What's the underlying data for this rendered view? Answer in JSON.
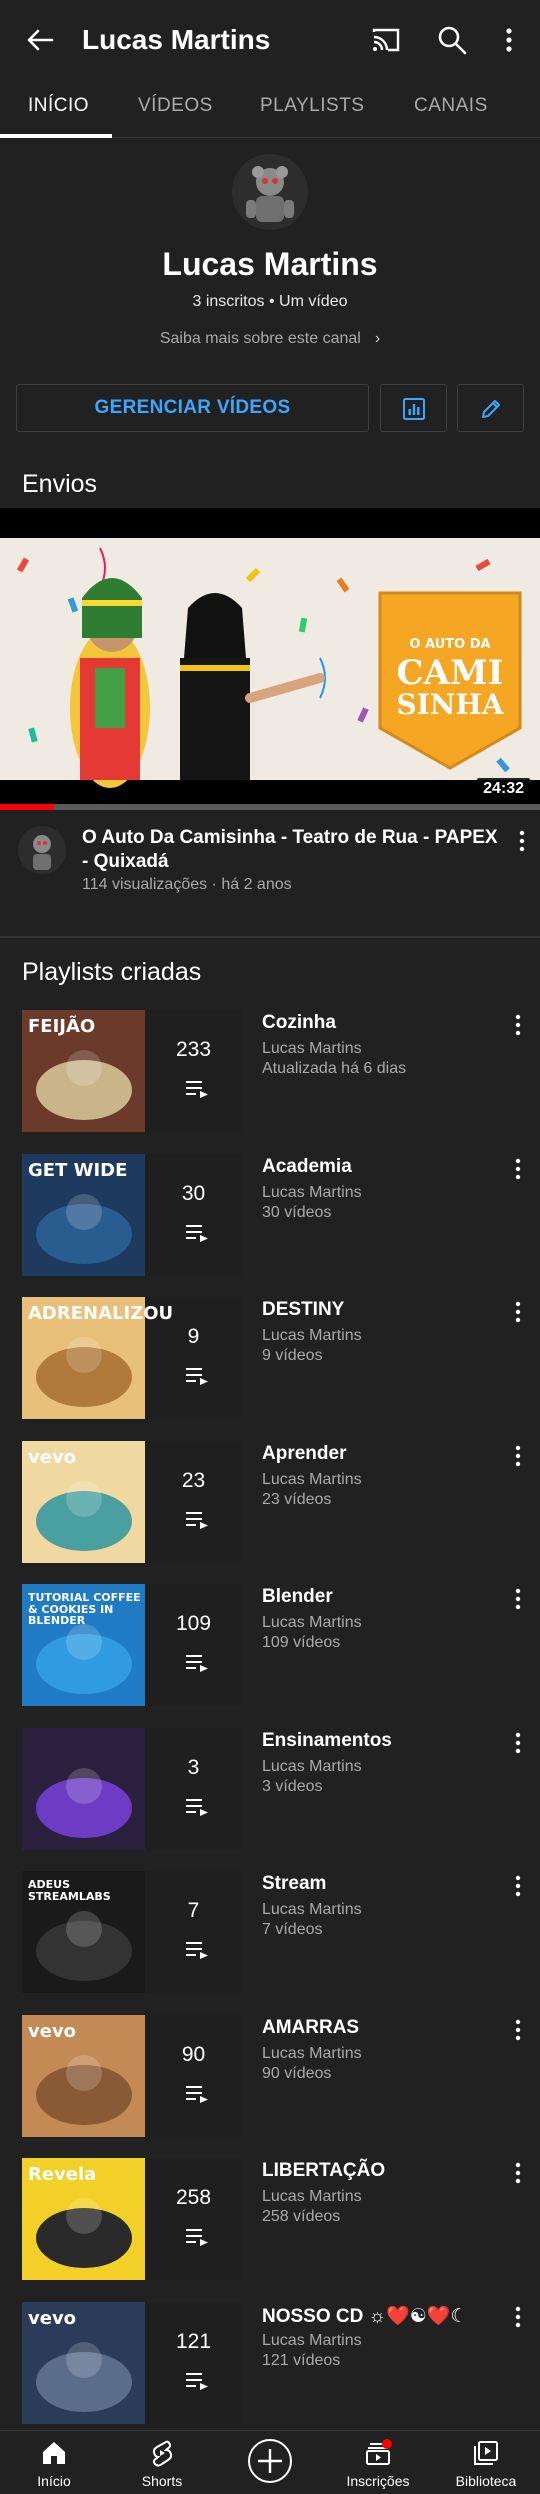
{
  "appbar": {
    "title": "Lucas Martins",
    "icons": [
      "back-arrow-icon",
      "cast-icon",
      "search-icon",
      "more-vert-icon"
    ]
  },
  "tabs": [
    {
      "label": "INÍCIO",
      "active": true
    },
    {
      "label": "VÍDEOS",
      "active": false
    },
    {
      "label": "PLAYLISTS",
      "active": false
    },
    {
      "label": "CANAIS",
      "active": false
    }
  ],
  "channel": {
    "name": "Lucas Martins",
    "meta": "3 inscritos • Um vídeo",
    "about": "Saiba mais sobre este canal",
    "manage_label": "GERENCIAR VÍDEOS"
  },
  "uploads": {
    "section_title": "Envios",
    "video": {
      "title": "O Auto Da Camisinha - Teatro de Rua - PAPEX - Quixadá",
      "meta": "114 visualizações · há 2 anos",
      "duration": "24:32",
      "thumb_text": [
        "O AUTO DA",
        "CAMI",
        "SINHA"
      ],
      "watched_fraction": 0.1
    }
  },
  "playlists": {
    "section_title": "Playlists criadas",
    "items": [
      {
        "name": "Cozinha",
        "owner": "Lucas Martins",
        "sub": "Atualizada há 6 dias",
        "count": "233",
        "art_text": "FEIJÃO"
      },
      {
        "name": "Academia",
        "owner": "Lucas Martins",
        "sub": "30 vídeos",
        "count": "30",
        "art_text": "GET WIDE"
      },
      {
        "name": "DESTINY",
        "owner": "Lucas Martins",
        "sub": "9 vídeos",
        "count": "9",
        "art_text": "ADRENALIZOU"
      },
      {
        "name": "Aprender",
        "owner": "Lucas Martins",
        "sub": "23 vídeos",
        "count": "23",
        "art_text": "vevo"
      },
      {
        "name": "Blender",
        "owner": "Lucas Martins",
        "sub": "109 vídeos",
        "count": "109",
        "art_text": "TUTORIAL COFFEE & COOKIES IN BLENDER"
      },
      {
        "name": "Ensinamentos",
        "owner": "Lucas Martins",
        "sub": "3 vídeos",
        "count": "3",
        "art_text": ""
      },
      {
        "name": "Stream",
        "owner": "Lucas Martins",
        "sub": "7 vídeos",
        "count": "7",
        "art_text": "ADEUS STREAMLABS"
      },
      {
        "name": "AMARRAS",
        "owner": "Lucas Martins",
        "sub": "90 vídeos",
        "count": "90",
        "art_text": "vevo"
      },
      {
        "name": "LIBERTAÇÃO",
        "owner": "Lucas Martins",
        "sub": "258 vídeos",
        "count": "258",
        "art_text": "Revela"
      },
      {
        "name": "NOSSO CD ☼❤️☯❤️☾",
        "owner": "Lucas Martins",
        "sub": "121 vídeos",
        "count": "121",
        "art_text": "vevo"
      }
    ]
  },
  "bottomnav": [
    {
      "label": "Início",
      "icon": "home-icon"
    },
    {
      "label": "Shorts",
      "icon": "shorts-icon"
    },
    {
      "label": "",
      "icon": "create-icon"
    },
    {
      "label": "Inscrições",
      "icon": "subscriptions-icon"
    },
    {
      "label": "Biblioteca",
      "icon": "library-icon"
    }
  ],
  "colors": {
    "background": "#212121",
    "accent_blue": "#3ea6ff",
    "red": "#ff0000"
  }
}
